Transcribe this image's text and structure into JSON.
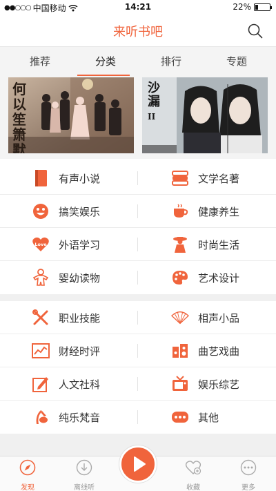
{
  "status_bar": {
    "carrier": "中国移动",
    "time": "14:21",
    "battery_percent": "22%",
    "battery_level": 0.22
  },
  "header": {
    "title": "来听书吧",
    "search_icon": "search-icon"
  },
  "tabs": [
    {
      "label": "推荐"
    },
    {
      "label": "分类"
    },
    {
      "label": "排行"
    },
    {
      "label": "专题"
    }
  ],
  "banner": {
    "left_poster_text": "何以笙箫默",
    "right_poster_text": "沙漏",
    "right_poster_sub": "II"
  },
  "section1": [
    [
      {
        "label": "有声小说",
        "icon": "book-icon"
      },
      {
        "label": "文学名著",
        "icon": "books-stack-icon"
      }
    ],
    [
      {
        "label": "搞笑娱乐",
        "icon": "smiley-icon"
      },
      {
        "label": "健康养生",
        "icon": "tea-cup-icon"
      }
    ],
    [
      {
        "label": "外语学习",
        "icon": "love-heart-icon"
      },
      {
        "label": "时尚生活",
        "icon": "fashion-lady-icon"
      }
    ],
    [
      {
        "label": "婴幼读物",
        "icon": "gingerbread-icon"
      },
      {
        "label": "艺术设计",
        "icon": "palette-icon"
      }
    ]
  ],
  "section2": [
    [
      {
        "label": "职业技能",
        "icon": "tools-icon"
      },
      {
        "label": "相声小品",
        "icon": "fan-icon"
      }
    ],
    [
      {
        "label": "财经时评",
        "icon": "chart-icon"
      },
      {
        "label": "曲艺戏曲",
        "icon": "speaker-icon"
      }
    ],
    [
      {
        "label": "人文社科",
        "icon": "pen-icon"
      },
      {
        "label": "娱乐综艺",
        "icon": "tv-icon"
      }
    ],
    [
      {
        "label": "纯乐梵音",
        "icon": "music-note-icon"
      },
      {
        "label": "其他",
        "icon": "more-dots-icon"
      }
    ]
  ],
  "bottom_nav": {
    "discover": "发现",
    "offline": "离线听",
    "favorites": "收藏",
    "more": "更多"
  },
  "colors": {
    "accent": "#f0643c",
    "tab_bg": "#f4f4f4",
    "divider": "#ececec"
  }
}
